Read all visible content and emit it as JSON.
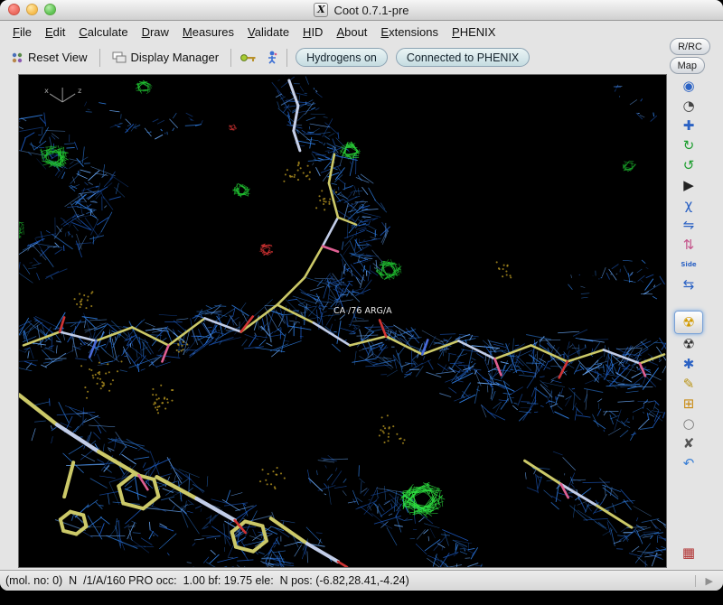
{
  "window": {
    "title": "Coot 0.7.1-pre",
    "x11_icon": "X"
  },
  "menubar": {
    "items": [
      {
        "id": "file",
        "label": "File"
      },
      {
        "id": "edit",
        "label": "Edit"
      },
      {
        "id": "calculate",
        "label": "Calculate"
      },
      {
        "id": "draw",
        "label": "Draw"
      },
      {
        "id": "measures",
        "label": "Measures"
      },
      {
        "id": "validate",
        "label": "Validate"
      },
      {
        "id": "hid",
        "label": "HID"
      },
      {
        "id": "about",
        "label": "About"
      },
      {
        "id": "extensions",
        "label": "Extensions"
      },
      {
        "id": "phenix",
        "label": "PHENIX"
      }
    ]
  },
  "toolbar": {
    "reset_view": "Reset View",
    "display_manager": "Display Manager",
    "hydrogens": "Hydrogens on",
    "phenix": "Connected to PHENIX"
  },
  "map_controls": {
    "rrc": "R/RC",
    "map": "Map"
  },
  "side_toolbar": {
    "icons": [
      {
        "name": "refine-sphere",
        "glyph": "◉",
        "color": "#2b62c4"
      },
      {
        "name": "tandem-refine",
        "glyph": "◔",
        "color": "#444444"
      },
      {
        "name": "rigid-body-fit",
        "glyph": "✚",
        "color": "#2b62c4"
      },
      {
        "name": "rotate-translate",
        "glyph": "↻",
        "color": "#1d9e2f"
      },
      {
        "name": "auto-fit-rotamer",
        "glyph": "↺",
        "color": "#1d9e2f"
      },
      {
        "name": "rotamers",
        "glyph": "▶",
        "color": "#222222"
      },
      {
        "name": "edit-chi-angles",
        "glyph": "χ",
        "color": "#2b62c4"
      },
      {
        "name": "torsion-general",
        "glyph": "⇋",
        "color": "#2b62c4"
      },
      {
        "name": "flip-peptide",
        "glyph": "⇅",
        "color": "#c4538a"
      },
      {
        "name": "sidechain-180",
        "glyph": "Side",
        "color": "#2b62c4",
        "text": true
      },
      {
        "name": "jed-flip",
        "glyph": "⇆",
        "color": "#2b62c4"
      },
      {
        "name": "simple-mutate",
        "glyph": "☢",
        "color": "#d29a00",
        "pressed": true,
        "gap": true
      },
      {
        "name": "mutate-autofit",
        "glyph": "☢",
        "color": "#333333"
      },
      {
        "name": "add-terminal-residue",
        "glyph": "✱",
        "color": "#2b62c4"
      },
      {
        "name": "pointer-atom",
        "glyph": "✎",
        "color": "#b99312"
      },
      {
        "name": "add-alt-conf",
        "glyph": "⊞",
        "color": "#c98a12"
      },
      {
        "name": "clear-pending",
        "glyph": "○",
        "color": "#777777"
      },
      {
        "name": "delete-item",
        "glyph": "✘",
        "color": "#555555"
      },
      {
        "name": "undo",
        "glyph": "↶",
        "color": "#3a7fd5"
      },
      {
        "name": "display-images",
        "glyph": "▦",
        "color": "#b03030",
        "bottom": true
      }
    ]
  },
  "canvas": {
    "residue_label": "CA /76 ARG/A",
    "axes": {
      "x": "x",
      "z": "z"
    },
    "colors": {
      "density_map": "#2f7de0",
      "positive_difference": "#21c232",
      "negative_difference": "#d23333",
      "carbon_bond": "#ccc968",
      "background": "#000000"
    }
  },
  "statusbar": {
    "text": "(mol. no: 0)  N  /1/A/160 PRO occ:  1.00 bf: 19.75 ele:  N pos: (-6.82,28.41,-4.24)",
    "expand_glyph": "▶"
  }
}
